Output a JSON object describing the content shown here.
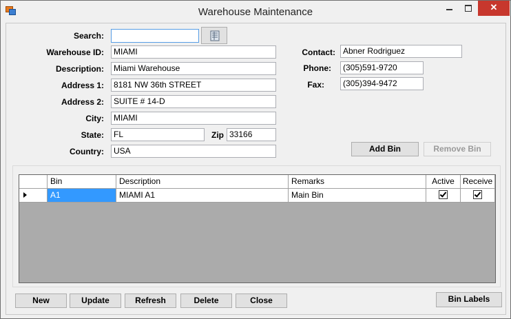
{
  "window": {
    "title": "Warehouse Maintenance",
    "close_glyph": "✕"
  },
  "form": {
    "search_label": "Search:",
    "search_value": "",
    "warehouse_id_label": "Warehouse ID:",
    "warehouse_id": "MIAMI",
    "description_label": "Description:",
    "description": "Miami Warehouse",
    "address1_label": "Address 1:",
    "address1": "8181 NW 36th STREET",
    "address2_label": "Address 2:",
    "address2": "SUITE # 14-D",
    "city_label": "City:",
    "city": "MIAMI",
    "state_label": "State:",
    "state": "FL",
    "zip_label": "Zip",
    "zip": "33166",
    "country_label": "Country:",
    "country": "USA",
    "contact_label": "Contact:",
    "contact": "Abner Rodriguez",
    "phone_label": "Phone:",
    "phone": "(305)591-9720",
    "fax_label": "Fax:",
    "fax": "(305)394-9472"
  },
  "bin_buttons": {
    "add": "Add Bin",
    "remove": "Remove Bin"
  },
  "grid": {
    "columns": [
      "Bin",
      "Description",
      "Remarks",
      "Active",
      "Receive"
    ],
    "rows": [
      {
        "bin": "A1",
        "description": "MIAMI A1",
        "remarks": "Main Bin",
        "active": true,
        "receive": true
      }
    ]
  },
  "actions": {
    "new": "New",
    "update": "Update",
    "refresh": "Refresh",
    "delete": "Delete",
    "close": "Close",
    "bin_labels": "Bin Labels"
  },
  "icons": [
    "app-icon",
    "minimize-icon",
    "maximize-icon",
    "close-icon",
    "lookup-icon",
    "row-pointer-icon",
    "checkbox-checked-icon"
  ]
}
